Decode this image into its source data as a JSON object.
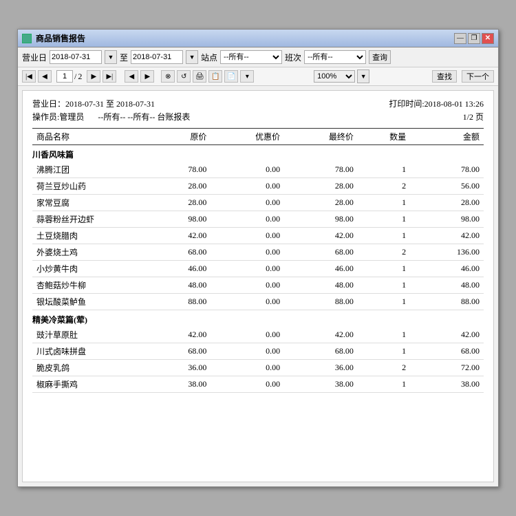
{
  "window": {
    "title": "商品销售报告",
    "icon": "chart-icon"
  },
  "toolbar": {
    "label_date": "营业日",
    "date_from": "2018-07-31",
    "date_to": "2018-07-31",
    "label_to": "至",
    "label_station": "站点",
    "station_value": "--所有--",
    "label_shift": "班次",
    "shift_value": "--所有--",
    "query_btn": "查询"
  },
  "nav": {
    "page_current": "1",
    "page_total": "2",
    "zoom": "100%",
    "find_btn": "查找",
    "next_btn": "下一个"
  },
  "report": {
    "date_range_label": "营业日：2018-07-31 至 2018-07-31",
    "print_time_label": "打印时间:2018-08-01 13:26",
    "operator_label": "操作员:管理员",
    "filter_label": "--所有-- --所有-- 台账报表",
    "page_label": "1/2 页",
    "columns": {
      "name": "商品名称",
      "original": "原价",
      "discount": "优惠价",
      "final": "最终价",
      "qty": "数量",
      "amount": "金额"
    },
    "categories": [
      {
        "name": "川香风味篇",
        "items": [
          {
            "name": "沸腾江团",
            "original": "78.00",
            "discount": "0.00",
            "final": "78.00",
            "qty": "1",
            "amount": "78.00"
          },
          {
            "name": "荷兰豆炒山药",
            "original": "28.00",
            "discount": "0.00",
            "final": "28.00",
            "qty": "2",
            "amount": "56.00"
          },
          {
            "name": "家常豆腐",
            "original": "28.00",
            "discount": "0.00",
            "final": "28.00",
            "qty": "1",
            "amount": "28.00"
          },
          {
            "name": "蒜蓉粉丝开边虾",
            "original": "98.00",
            "discount": "0.00",
            "final": "98.00",
            "qty": "1",
            "amount": "98.00"
          },
          {
            "name": "土豆烧腊肉",
            "original": "42.00",
            "discount": "0.00",
            "final": "42.00",
            "qty": "1",
            "amount": "42.00"
          },
          {
            "name": "外婆烧土鸡",
            "original": "68.00",
            "discount": "0.00",
            "final": "68.00",
            "qty": "2",
            "amount": "136.00"
          },
          {
            "name": "小炒黄牛肉",
            "original": "46.00",
            "discount": "0.00",
            "final": "46.00",
            "qty": "1",
            "amount": "46.00"
          },
          {
            "name": "杏鲍菇炒牛柳",
            "original": "48.00",
            "discount": "0.00",
            "final": "48.00",
            "qty": "1",
            "amount": "48.00"
          },
          {
            "name": "银坛酸菜鲈鱼",
            "original": "88.00",
            "discount": "0.00",
            "final": "88.00",
            "qty": "1",
            "amount": "88.00"
          }
        ]
      },
      {
        "name": "精美冷菜篇(荤)",
        "items": [
          {
            "name": "豉汁草原肚",
            "original": "42.00",
            "discount": "0.00",
            "final": "42.00",
            "qty": "1",
            "amount": "42.00"
          },
          {
            "name": "川式卤味拼盘",
            "original": "68.00",
            "discount": "0.00",
            "final": "68.00",
            "qty": "1",
            "amount": "68.00"
          },
          {
            "name": "脆皮乳鸽",
            "original": "36.00",
            "discount": "0.00",
            "final": "36.00",
            "qty": "2",
            "amount": "72.00"
          },
          {
            "name": "椒麻手撕鸡",
            "original": "38.00",
            "discount": "0.00",
            "final": "38.00",
            "qty": "1",
            "amount": "38.00"
          }
        ]
      }
    ]
  }
}
